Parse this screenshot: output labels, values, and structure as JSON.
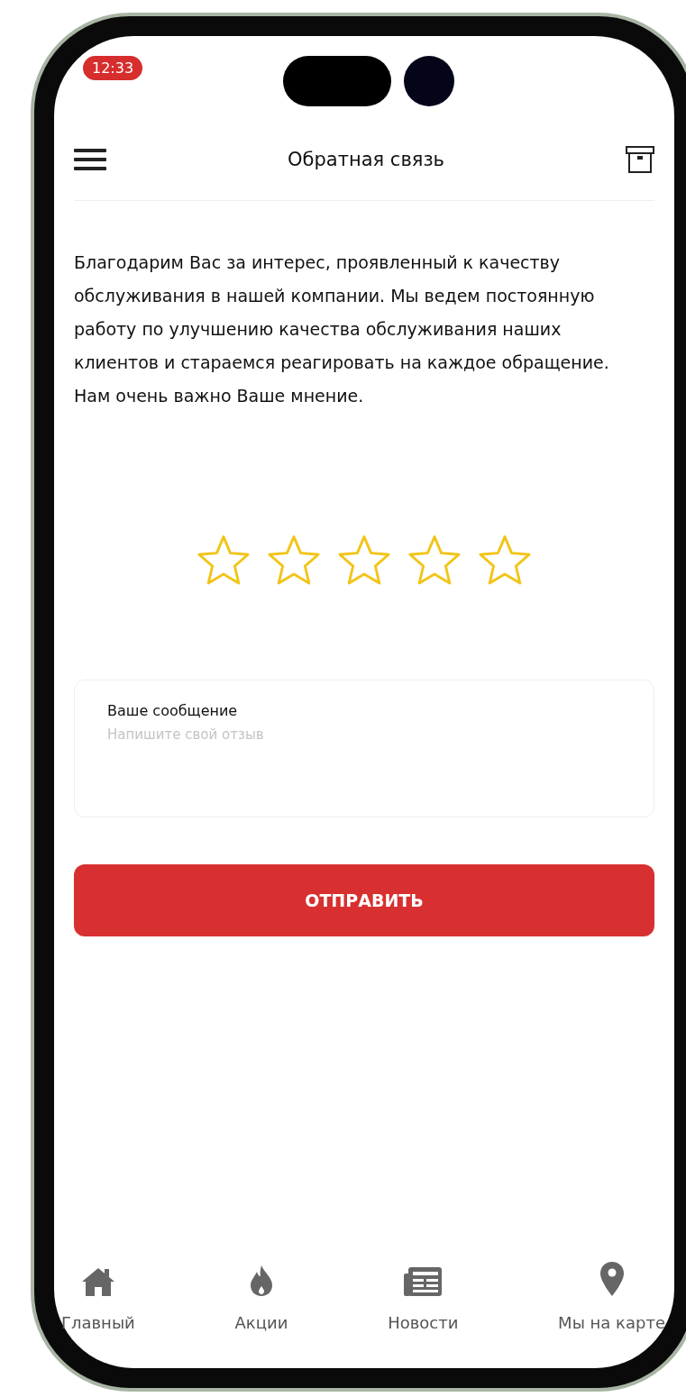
{
  "status_bar": {
    "time": "12:33"
  },
  "header": {
    "title": "Обратная связь"
  },
  "intro": "Благодарим Вас за интерес, проявленный к качеству обслуживания в нашей компании. Мы ведем постоянную работу по улучшению качества обслуживания наших клиентов и стараемся реагировать на каждое обращение. Нам очень важно Ваше мнение.",
  "rating": {
    "stars": 0
  },
  "message": {
    "label": "Ваше сообщение",
    "placeholder": "Напишите свой отзыв"
  },
  "submit_button": "ОТПРАВИТЬ",
  "bottom_nav": [
    {
      "label": "Главный",
      "kind": "home"
    },
    {
      "label": "Акции",
      "kind": "flame"
    },
    {
      "label": "Новости",
      "kind": "news"
    },
    {
      "label": "Мы на карте",
      "kind": "pin"
    }
  ]
}
